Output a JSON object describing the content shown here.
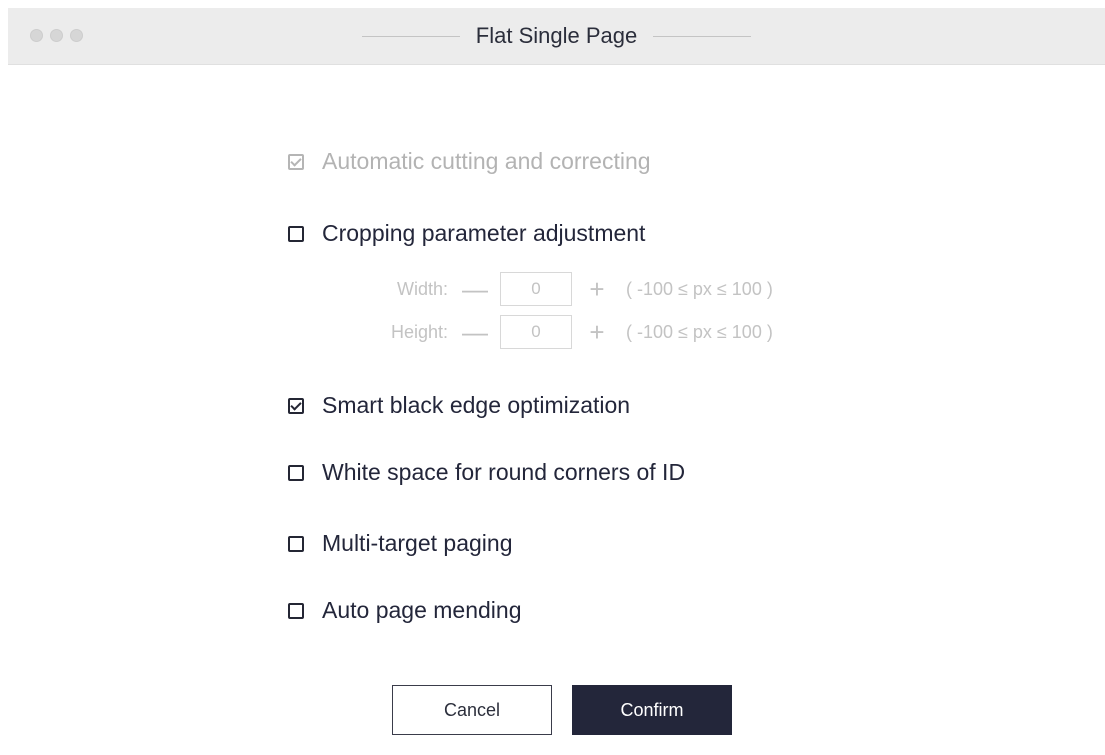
{
  "window": {
    "title": "Flat Single Page"
  },
  "options": [
    {
      "label": "Automatic cutting and correcting",
      "checked": true,
      "disabled": true
    },
    {
      "label": "Cropping parameter adjustment",
      "checked": false,
      "disabled": false
    },
    {
      "label": "Smart black edge optimization",
      "checked": true,
      "disabled": false
    },
    {
      "label": "White space for round corners of ID",
      "checked": false,
      "disabled": false
    },
    {
      "label": "Multi-target paging",
      "checked": false,
      "disabled": false
    },
    {
      "label": "Auto page mending",
      "checked": false,
      "disabled": false
    }
  ],
  "crop_params": {
    "width": {
      "label": "Width:",
      "value": "0",
      "minus": "—",
      "plus": "+",
      "range": "( -100 ≤ px ≤ 100 )"
    },
    "height": {
      "label": "Height:",
      "value": "0",
      "minus": "—",
      "plus": "+",
      "range": "( -100 ≤ px ≤ 100 )"
    }
  },
  "buttons": {
    "cancel": "Cancel",
    "confirm": "Confirm"
  }
}
